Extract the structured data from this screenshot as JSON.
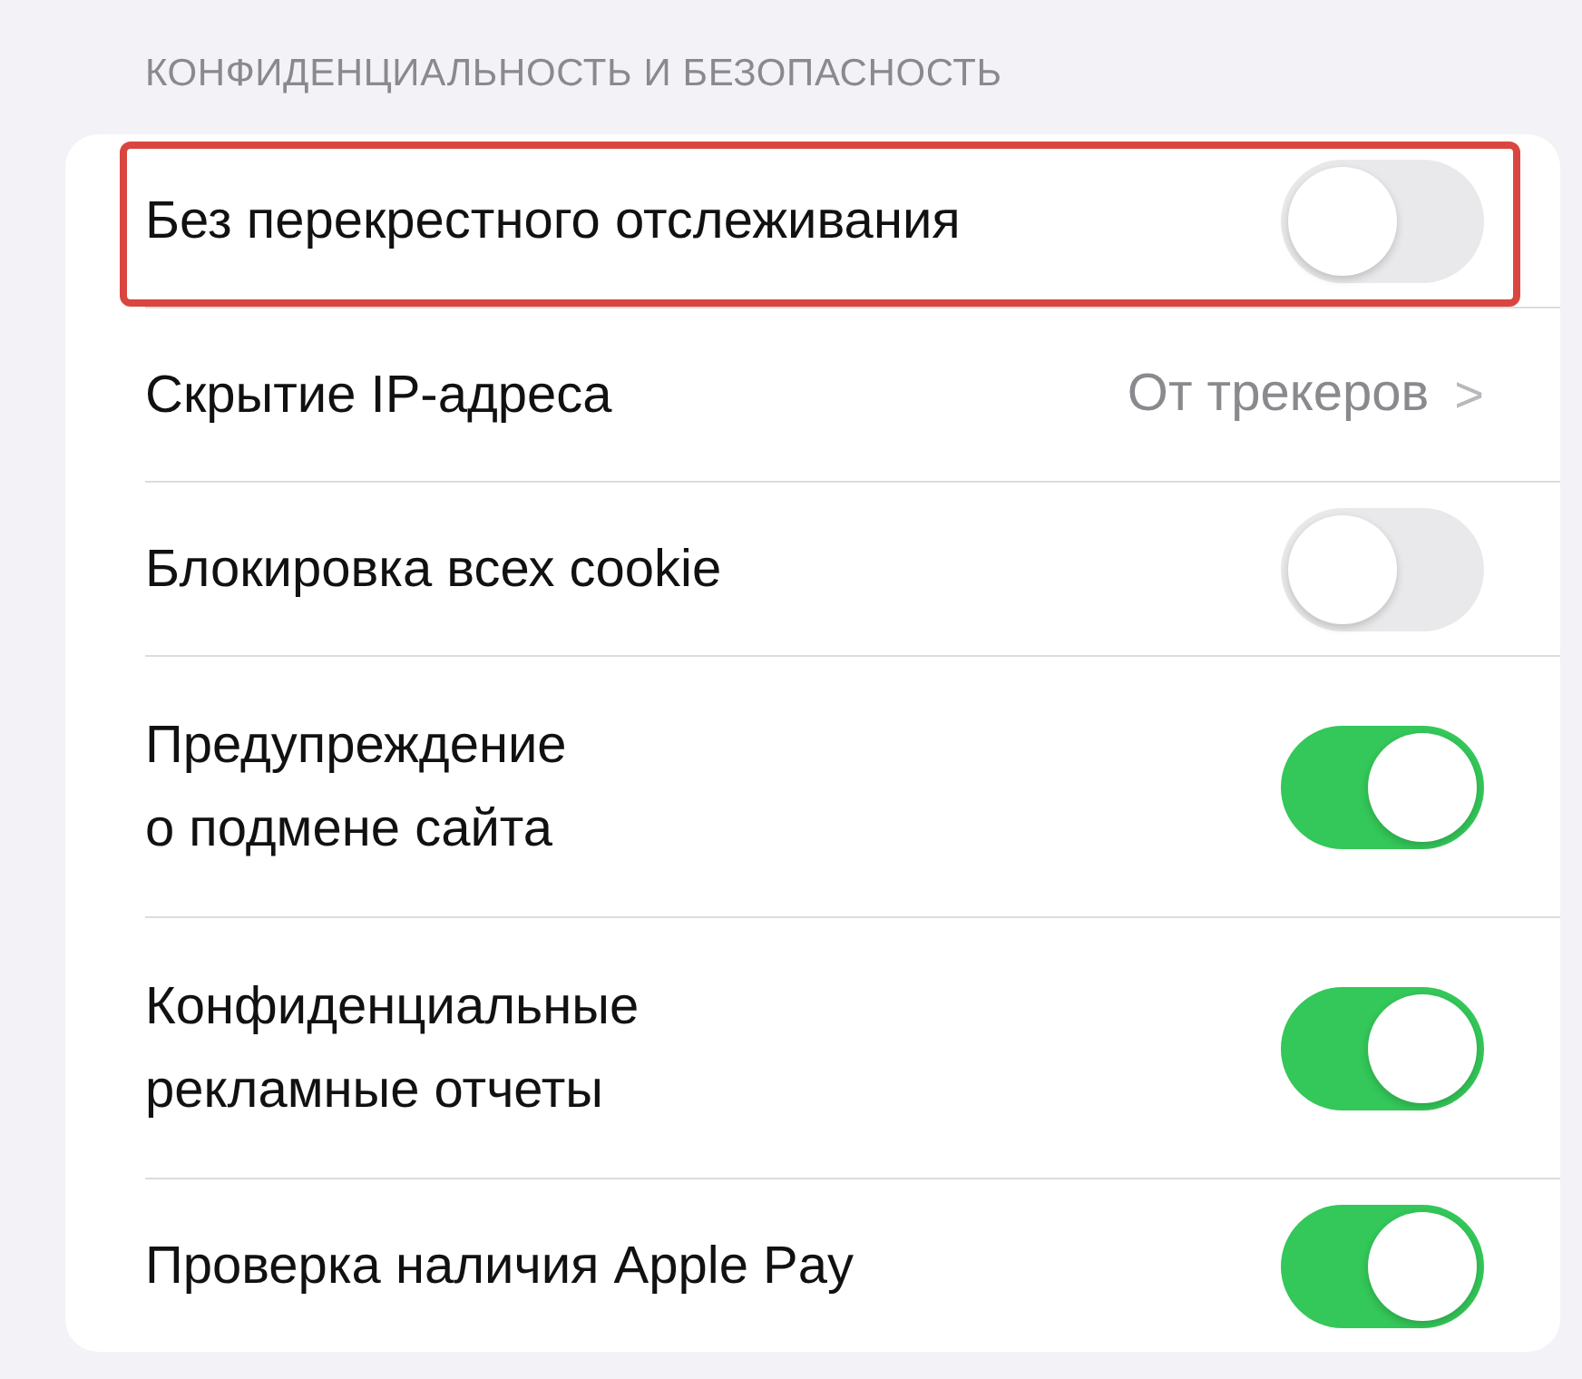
{
  "section": {
    "header": "КОНФИДЕНЦИАЛЬНОСТЬ И БЕЗОПАСНОСТЬ",
    "rows": [
      {
        "kind": "toggle",
        "label": "Без перекрестного отслеживания",
        "on": false,
        "highlighted": true
      },
      {
        "kind": "link",
        "label": "Скрытие IP-адреса",
        "value": "От трекеров",
        "chevron": ">",
        "highlighted": false
      },
      {
        "kind": "toggle",
        "label": "Блокировка всех cookie",
        "on": false,
        "highlighted": false
      },
      {
        "kind": "toggle",
        "label": "Предупреждение\nо подмене сайта",
        "on": true,
        "highlighted": false
      },
      {
        "kind": "toggle",
        "label": "Конфиденциальные\nрекламные отчеты",
        "on": true,
        "highlighted": false
      },
      {
        "kind": "toggle",
        "label": "Проверка наличия Apple Pay",
        "on": true,
        "highlighted": false
      }
    ]
  }
}
